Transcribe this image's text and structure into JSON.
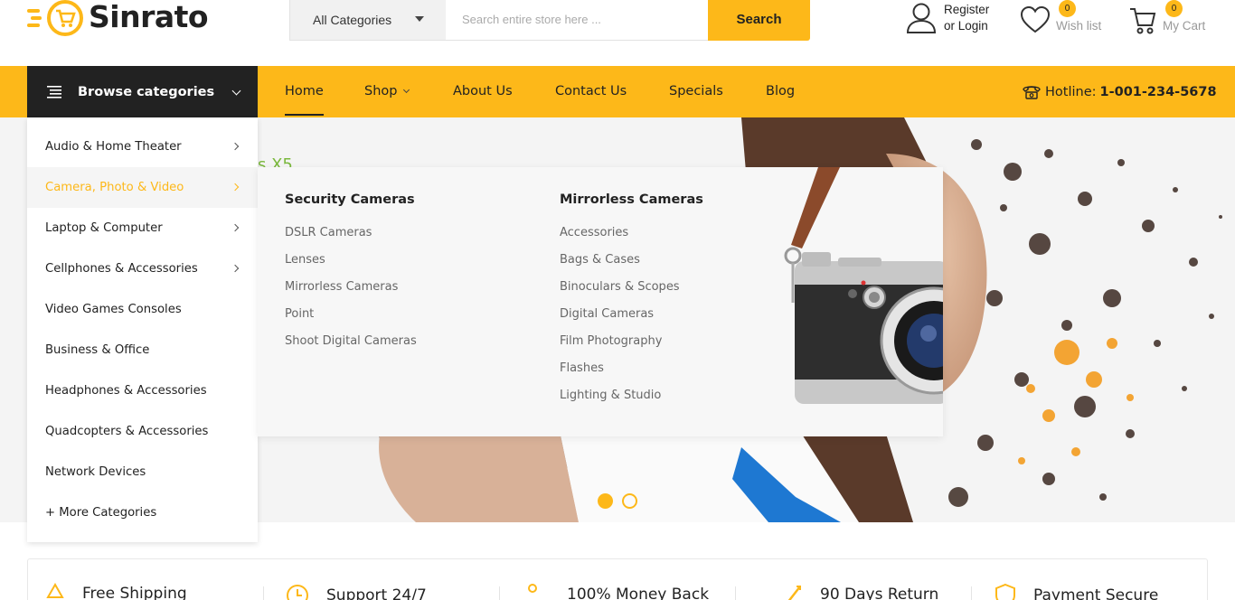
{
  "brand": {
    "name": "Sinrato",
    "accent": "#fdb819",
    "dark": "#222222"
  },
  "search": {
    "category": "All Categories",
    "placeholder": "Search entire store here ...",
    "button": "Search"
  },
  "account": {
    "line1": "Register",
    "line2": "or Login"
  },
  "wishlist": {
    "label": "Wish list",
    "count": "0"
  },
  "cart": {
    "label": "My Cart",
    "count": "0"
  },
  "browse": {
    "label": "Browse categories"
  },
  "nav": {
    "items": [
      {
        "label": "Home",
        "active": true
      },
      {
        "label": "Shop",
        "dropdown": true
      },
      {
        "label": "About Us"
      },
      {
        "label": "Contact Us"
      },
      {
        "label": "Specials"
      },
      {
        "label": "Blog"
      }
    ],
    "hotline_label": "Hotline:",
    "hotline_number": "1-001-234-5678"
  },
  "hero": {
    "promo_fragment": "s X5"
  },
  "categories": [
    {
      "label": "Audio & Home Theater",
      "submenu": true
    },
    {
      "label": "Camera, Photo & Video",
      "submenu": true,
      "highlighted": true
    },
    {
      "label": "Laptop & Computer",
      "submenu": true
    },
    {
      "label": "Cellphones & Accessories",
      "submenu": true
    },
    {
      "label": "Video Games Consoles"
    },
    {
      "label": "Business & Office"
    },
    {
      "label": "Headphones & Accessories"
    },
    {
      "label": "Quadcopters & Accessories"
    },
    {
      "label": "Network Devices"
    },
    {
      "label": "+ More Categories"
    }
  ],
  "mega_menu": {
    "columns": [
      {
        "title": "Security Cameras",
        "links": [
          "DSLR Cameras",
          "Lenses",
          "Mirrorless Cameras",
          "Point",
          "Shoot Digital Cameras"
        ]
      },
      {
        "title": "Mirrorless Cameras",
        "links": [
          "Accessories",
          "Bags & Cases",
          "Binoculars & Scopes",
          "Digital Cameras",
          "Film Photography",
          "Flashes",
          "Lighting & Studio"
        ]
      }
    ]
  },
  "slider": {
    "slides": 2,
    "active": 1
  },
  "services": [
    {
      "label": "Free Shipping",
      "icon": "truck-icon"
    },
    {
      "label": "Support 24/7",
      "icon": "clock-icon"
    },
    {
      "label": "100% Money Back",
      "icon": "route-icon"
    },
    {
      "label": "90 Days Return",
      "icon": "return-icon"
    },
    {
      "label": "Payment Secure",
      "icon": "shield-icon"
    }
  ]
}
